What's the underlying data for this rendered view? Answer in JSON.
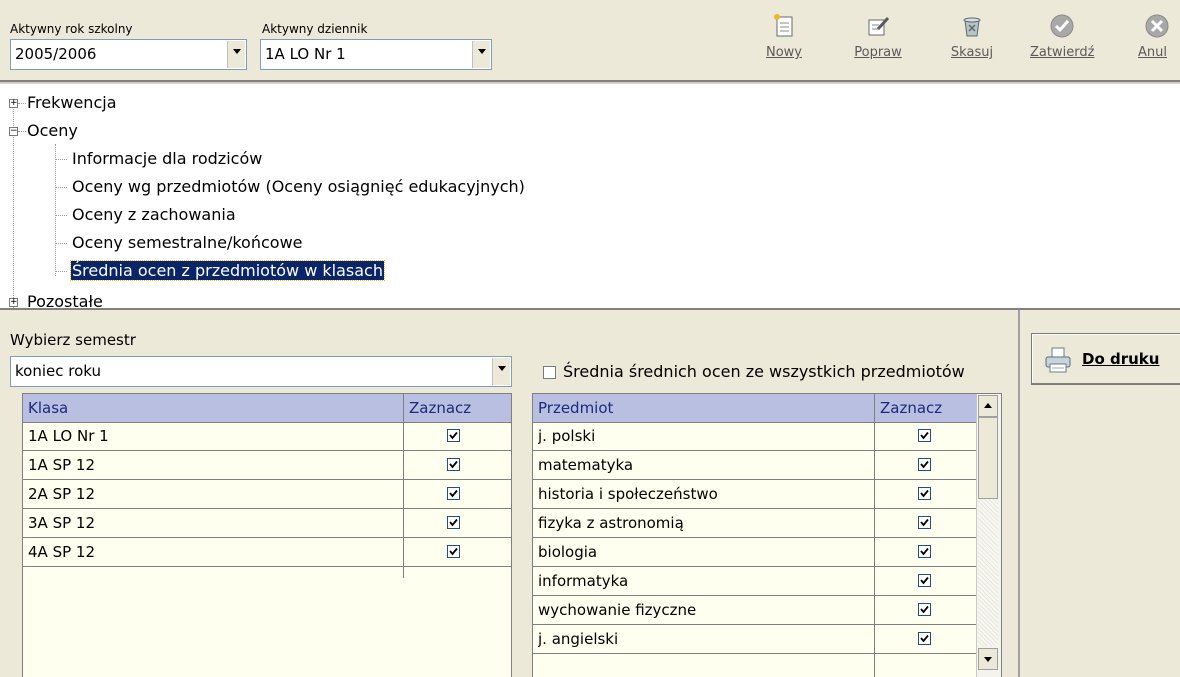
{
  "toolbar": {
    "school_year_label": "Aktywny rok szkolny",
    "school_year_value": "2005/2006",
    "journal_label": "Aktywny dziennik",
    "journal_value": "1A  LO Nr 1",
    "buttons": [
      {
        "label": "Nowy",
        "icon": "new-document-icon"
      },
      {
        "label": "Popraw",
        "icon": "edit-icon"
      },
      {
        "label": "Skasuj",
        "icon": "delete-icon"
      },
      {
        "label": "Zatwierdź",
        "icon": "confirm-icon"
      },
      {
        "label": "Anul",
        "icon": "cancel-icon"
      }
    ]
  },
  "tree": {
    "nodes": [
      {
        "label": "Frekwencja",
        "expander": "+"
      },
      {
        "label": "Oceny",
        "expander": "−"
      },
      {
        "label": "Informacje dla rodziców"
      },
      {
        "label": "Oceny wg przedmiotów (Oceny osiągnięć edukacyjnych)"
      },
      {
        "label": "Oceny z zachowania"
      },
      {
        "label": "Oceny semestralne/końcowe"
      },
      {
        "label": "Średnia ocen z przedmiotów w klasach",
        "selected": true
      },
      {
        "label": "Pozostałe",
        "expander": "+"
      }
    ]
  },
  "semester": {
    "label": "Wybierz semestr",
    "value": "koniec roku"
  },
  "average_all": {
    "label": "Średnia średnich ocen ze wszystkich przedmiotów",
    "checked": false
  },
  "class_grid": {
    "headers": [
      "Klasa",
      "Zaznacz"
    ],
    "rows": [
      {
        "name": "1A  LO Nr 1",
        "checked": true
      },
      {
        "name": "1A  SP 12",
        "checked": true
      },
      {
        "name": "2A  SP 12",
        "checked": true
      },
      {
        "name": "3A  SP 12",
        "checked": true
      },
      {
        "name": "4A  SP 12",
        "checked": true
      }
    ]
  },
  "subject_grid": {
    "headers": [
      "Przedmiot",
      "Zaznacz"
    ],
    "rows": [
      {
        "name": "j. polski",
        "checked": true
      },
      {
        "name": "matematyka",
        "checked": true
      },
      {
        "name": "historia i społeczeństwo",
        "checked": true
      },
      {
        "name": "fizyka z astronomią",
        "checked": true
      },
      {
        "name": "biologia",
        "checked": true
      },
      {
        "name": "informatyka",
        "checked": true
      },
      {
        "name": "wychowanie fizyczne",
        "checked": true
      },
      {
        "name": "j. angielski",
        "checked": true
      }
    ]
  },
  "print_button": {
    "label": "Do druku",
    "icon": "printer-icon"
  },
  "colors": {
    "window_bg": "#ece9d8",
    "grid_header": "#b9bfe0",
    "grid_row": "#ffffef",
    "selection": "#0a246a"
  }
}
